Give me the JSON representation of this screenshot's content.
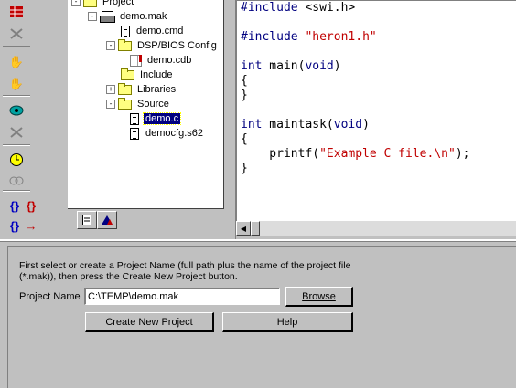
{
  "tree": {
    "items": [
      {
        "label": "Project",
        "type": "folder",
        "expander": "-"
      },
      {
        "label": "demo.mak",
        "type": "mak",
        "expander": "-"
      },
      {
        "label": "demo.cmd",
        "type": "doc",
        "expander": ""
      },
      {
        "label": "DSP/BIOS Config",
        "type": "folder",
        "expander": "-"
      },
      {
        "label": "demo.cdb",
        "type": "cdb",
        "expander": ""
      },
      {
        "label": "Include",
        "type": "folder",
        "expander": ""
      },
      {
        "label": "Libraries",
        "type": "folder",
        "expander": "+"
      },
      {
        "label": "Source",
        "type": "folder",
        "expander": "-"
      },
      {
        "label": "demo.c",
        "type": "doc",
        "expander": "",
        "selected": true
      },
      {
        "label": "democfg.s62",
        "type": "doc",
        "expander": ""
      }
    ]
  },
  "editor": {
    "lines": [
      {
        "parts": [
          {
            "t": "#include ",
            "c": "kw"
          },
          {
            "t": "<swi.h>",
            "c": ""
          }
        ]
      },
      {
        "parts": []
      },
      {
        "parts": [
          {
            "t": "#include ",
            "c": "kw"
          },
          {
            "t": "\"heron1.h\"",
            "c": "str"
          }
        ]
      },
      {
        "parts": []
      },
      {
        "parts": [
          {
            "t": "int",
            "c": "kw"
          },
          {
            "t": " main(",
            "c": ""
          },
          {
            "t": "void",
            "c": "kw"
          },
          {
            "t": ")",
            "c": ""
          }
        ]
      },
      {
        "parts": [
          {
            "t": "{",
            "c": ""
          }
        ]
      },
      {
        "parts": [
          {
            "t": "}",
            "c": ""
          }
        ]
      },
      {
        "parts": []
      },
      {
        "parts": [
          {
            "t": "int",
            "c": "kw"
          },
          {
            "t": " maintask(",
            "c": ""
          },
          {
            "t": "void",
            "c": "kw"
          },
          {
            "t": ")",
            "c": ""
          }
        ]
      },
      {
        "parts": [
          {
            "t": "{",
            "c": ""
          }
        ]
      },
      {
        "parts": [
          {
            "t": "    printf(",
            "c": ""
          },
          {
            "t": "\"Example C file.\\n\"",
            "c": "str"
          },
          {
            "t": ");",
            "c": ""
          }
        ]
      },
      {
        "parts": [
          {
            "t": "}",
            "c": ""
          }
        ]
      }
    ]
  },
  "bottom": {
    "instructions_line1": "First select or create a Project Name (full path plus the name of the project file",
    "instructions_line2": "(*.mak)), then press the Create New Project button.",
    "project_name_label": "Project Name",
    "project_name_value": "C:\\TEMP\\demo.mak",
    "browse_label": "Browse",
    "create_label": "Create New Project",
    "help_label": "Help"
  },
  "colors": {
    "keyword": "#000080",
    "string": "#c00000",
    "selection": "#000080",
    "window_bg": "#c0c0c0"
  }
}
